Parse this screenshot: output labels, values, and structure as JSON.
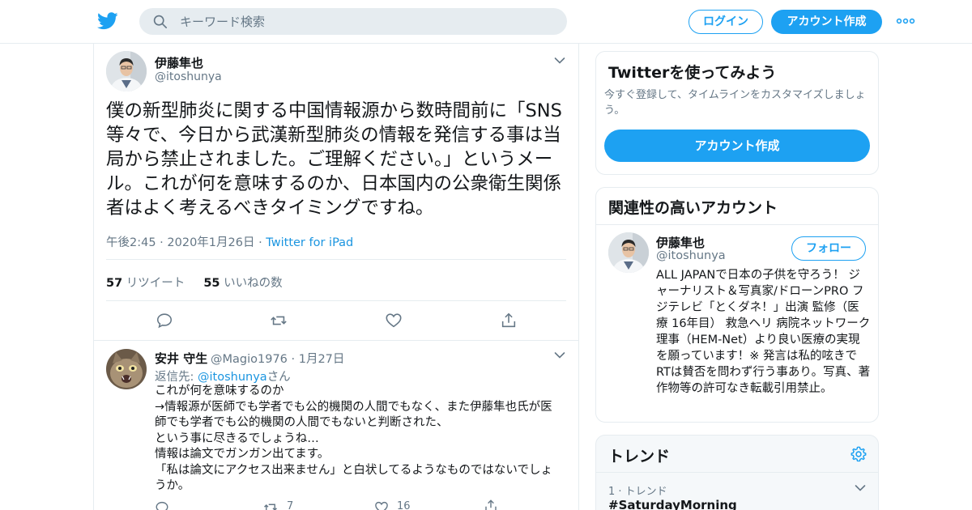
{
  "header": {
    "search_placeholder": "キーワード検索",
    "login_label": "ログイン",
    "signup_label": "アカウント作成",
    "brand_color": "#1da1f2",
    "logo_icon": "twitter-bird-icon",
    "more_icon": "more-dots-icon"
  },
  "tweet": {
    "author_name": "伊藤隼也",
    "author_handle": "@itoshunya",
    "text": "僕の新型肺炎に関する中国情報源から数時間前に「SNS等々で、今日から武漢新型肺炎の情報を発信する事は当局から禁止されました。ご理解ください。」というメール。これが何を意味するのか、日本国内の公衆衛生関係者はよく考えるべきタイミングですね。",
    "time": "午後2:45 · 2020年1月26日 · ",
    "source": "Twitter for iPad",
    "retweets_count": "57",
    "retweets_label": "リツイート",
    "likes_count": "55",
    "likes_label": "いいねの数"
  },
  "reply": {
    "author_name": "安井 守生",
    "author_handle": "@Magio1976 · 1月27日",
    "reply_prefix": "返信先: ",
    "reply_to": "@itoshunya",
    "reply_suffix": "さん",
    "lines": [
      "これが何を意味するのか",
      "→情報源が医師でも学者でも公的機関の人間でもなく、また伊藤隼也氏が医師でも学者でも公的機関の人間でもないと判断された、",
      "という事に尽きるでしょうね…",
      "情報は論文でガンガン出てます。",
      "「私は論文にアクセス出来ません」と白状してるようなものではないでしょうか。"
    ],
    "retweet_count": "7",
    "like_count": "16"
  },
  "sidebar": {
    "signup_card": {
      "title": "Twitterを使ってみよう",
      "subtitle": "今すぐ登録して、タイムラインをカスタマイズしましょう。",
      "button_label": "アカウント作成"
    },
    "related_card": {
      "title": "関連性の高いアカウント",
      "name": "伊藤隼也",
      "handle": "@itoshunya",
      "follow_label": "フォロー",
      "bio": "ALL JAPANで日本の子供を守ろう！ ジャーナリスト＆写真家/ドローンPRO フジテレビ「とくダネ！」出演 監修（医療 16年目） 救急ヘリ 病院ネットワーク理事（HEM-Net）より良い医療の実現を願っています！※ 発言は私的呟きでRTは賛否を問わず行う事あり。写真、著作物等の許可なき転載引用禁止。"
    },
    "trends_card": {
      "title": "トレンド",
      "settings_icon": "gear-icon",
      "trend_meta": "1 · トレンド",
      "trend_name": "#SaturdayMorning"
    }
  }
}
